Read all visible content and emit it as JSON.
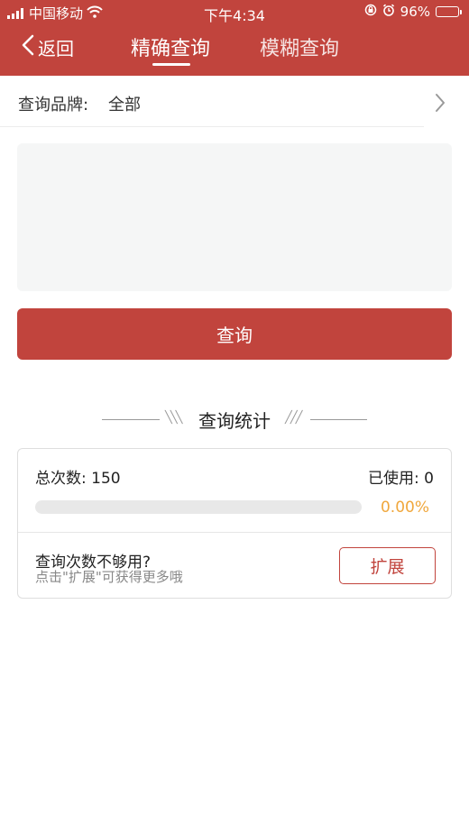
{
  "status_bar": {
    "carrier": "中国移动",
    "time": "下午4:34",
    "battery": "96%"
  },
  "header": {
    "back_label": "返回",
    "tabs": [
      {
        "label": "精确查询",
        "active": true
      },
      {
        "label": "模糊查询",
        "active": false
      }
    ]
  },
  "brand_filter": {
    "label": "查询品牌:",
    "value": "全部"
  },
  "query_input": {
    "value": "",
    "placeholder": ""
  },
  "query_button": {
    "label": "查询"
  },
  "stats": {
    "section_title": "查询统计",
    "total_label": "总次数: 150",
    "used_label": "已使用: 0",
    "progress_fraction": 0,
    "percent_text": "0.00%",
    "hint_main": "查询次数不够用?",
    "hint_sub": "点击\"扩展\"可获得更多哦",
    "expand_label": "扩展"
  },
  "colors": {
    "brand_red": "#c1443d",
    "accent_orange": "#f0a73c",
    "input_bg": "#f5f6f6"
  },
  "icons": [
    "cellular-signal-icon",
    "wifi-icon",
    "rotation-lock-icon",
    "alarm-icon",
    "battery-icon",
    "back-chevron-icon",
    "chevron-right-icon"
  ]
}
